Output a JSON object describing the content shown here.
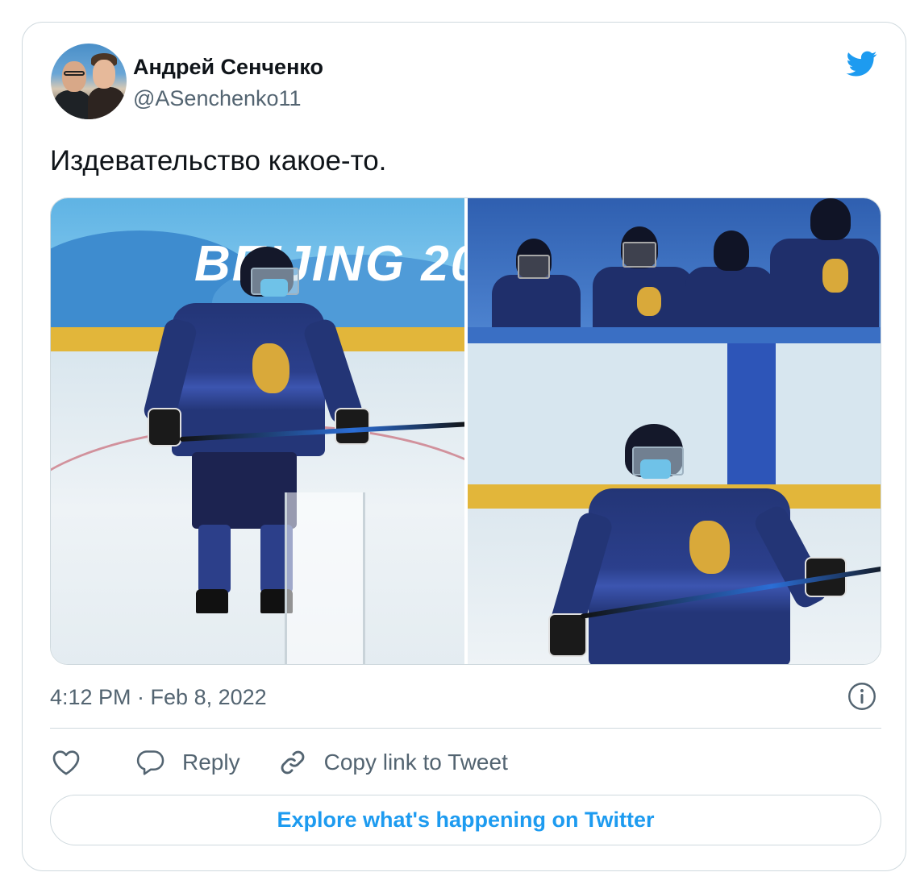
{
  "author": {
    "name": "Андрей Сенченко",
    "handle": "@ASenchenko11"
  },
  "tweet": {
    "text": "Издевательство какое-то.",
    "timestamp": "4:12 PM · Feb 8, 2022"
  },
  "media": {
    "left_photo_banner_text": "BEIJING 20"
  },
  "actions": {
    "reply_label": "Reply",
    "copy_link_label": "Copy link to Tweet"
  },
  "explore": {
    "label": "Explore what's happening on Twitter"
  },
  "colors": {
    "accent": "#1d9bf0",
    "muted_text": "#536471",
    "border": "#cfd9de"
  },
  "icons": [
    "twitter-bird-icon",
    "info-icon",
    "heart-icon",
    "reply-bubble-icon",
    "link-icon"
  ]
}
